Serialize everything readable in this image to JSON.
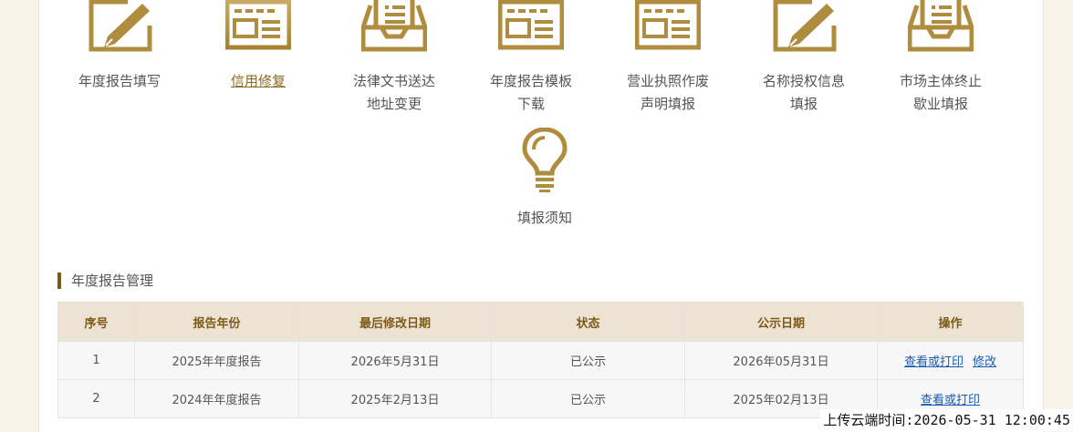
{
  "tiles": [
    {
      "label": [
        "年度报告填写"
      ],
      "icon": "pencil-form-icon"
    },
    {
      "label": [
        "信用修复"
      ],
      "icon": "document-icon",
      "active": true
    },
    {
      "label": [
        "法律文书送达",
        "地址变更"
      ],
      "icon": "inbox-tray-icon"
    },
    {
      "label": [
        "年度报告模板",
        "下载"
      ],
      "icon": "document-icon"
    },
    {
      "label": [
        "营业执照作废",
        "声明填报"
      ],
      "icon": "document-icon"
    },
    {
      "label": [
        "名称授权信息",
        "填报"
      ],
      "icon": "pencil-form-icon"
    },
    {
      "label": [
        "市场主体终止",
        "歇业填报"
      ],
      "icon": "inbox-tray-icon"
    },
    {
      "label": [
        "填报须知"
      ],
      "icon": "lightbulb-icon"
    }
  ],
  "section": {
    "title": "年度报告管理"
  },
  "table": {
    "headers": [
      "序号",
      "报告年份",
      "最后修改日期",
      "状态",
      "公示日期",
      "操作"
    ],
    "rows": [
      {
        "index": "1",
        "year": "2025年年度报告",
        "modified": "2026年5月31日",
        "status": "已公示",
        "published": "2026年05月31日",
        "actions": [
          "查看或打印",
          "修改"
        ]
      },
      {
        "index": "2",
        "year": "2024年年度报告",
        "modified": "2025年2月13日",
        "status": "已公示",
        "published": "2025年02月13日",
        "actions": [
          "查看或打印"
        ]
      }
    ]
  },
  "footer": {
    "upload_time": "上传云端时间:2026-05-31 12:00:45"
  },
  "colors": {
    "gold": "#b08c3e",
    "header_text": "#7d5a18",
    "link": "#1c5bb0"
  }
}
